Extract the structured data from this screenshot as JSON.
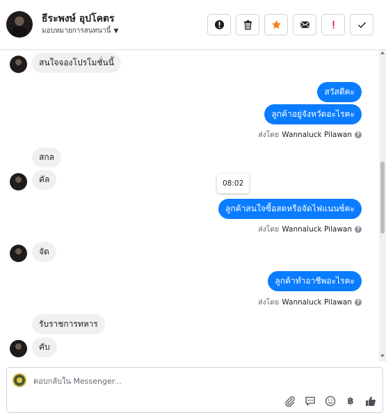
{
  "header": {
    "contact_name": "ธีระพงษ์ อุปโคตร",
    "assign_label": "มอบหมายการสนทนานี้",
    "toolbar": [
      {
        "icon": "alert-circle-icon",
        "color": "#1c1e21"
      },
      {
        "icon": "trash-icon",
        "color": "#1c1e21"
      },
      {
        "icon": "star-icon",
        "color": "#f5821f"
      },
      {
        "icon": "envelope-icon",
        "color": "#1c1e21"
      },
      {
        "icon": "exclamation-icon",
        "color": "#e41e3f"
      },
      {
        "icon": "check-icon",
        "color": "#1c1e21"
      }
    ]
  },
  "messages": {
    "in_1": "สนใจจองโปรโมชั่นนี้",
    "out_1": "สวัสดีคะ",
    "out_2": "ลูกค้าอยู่จังหวัดอะไรคะ",
    "sent_by_1": {
      "prefix": "ส่งโดย",
      "agent": "Wannaluck Pilawan"
    },
    "in_2": "สกล",
    "in_3": "คัล",
    "time_divider": "08:02",
    "out_3": "ลูกค้าสนใจซื้อสดหรือจัดไฟแนนซ์คะ",
    "sent_by_2": {
      "prefix": "ส่งโดย",
      "agent": "Wannaluck Pilawan"
    },
    "in_4": "จัด",
    "out_4": "ลูกค้าทำอาชีพอะไรคะ",
    "sent_by_3": {
      "prefix": "ส่งโดย",
      "agent": "Wannaluck Pilawan"
    },
    "in_5": "รับราชการทหาร",
    "in_6": "คับ"
  },
  "composer": {
    "placeholder": "ตอบกลับใน Messenger...",
    "baht_symbol": "฿",
    "tools": [
      "paperclip-icon",
      "chat-bubble-icon",
      "smiley-icon",
      "baht-icon",
      "thumbs-up-icon"
    ]
  },
  "colors": {
    "outgoing_bubble": "#0a7cff",
    "incoming_bubble": "#f0f0f0",
    "star_accent": "#f5821f",
    "exclamation_red": "#e41e3f"
  }
}
